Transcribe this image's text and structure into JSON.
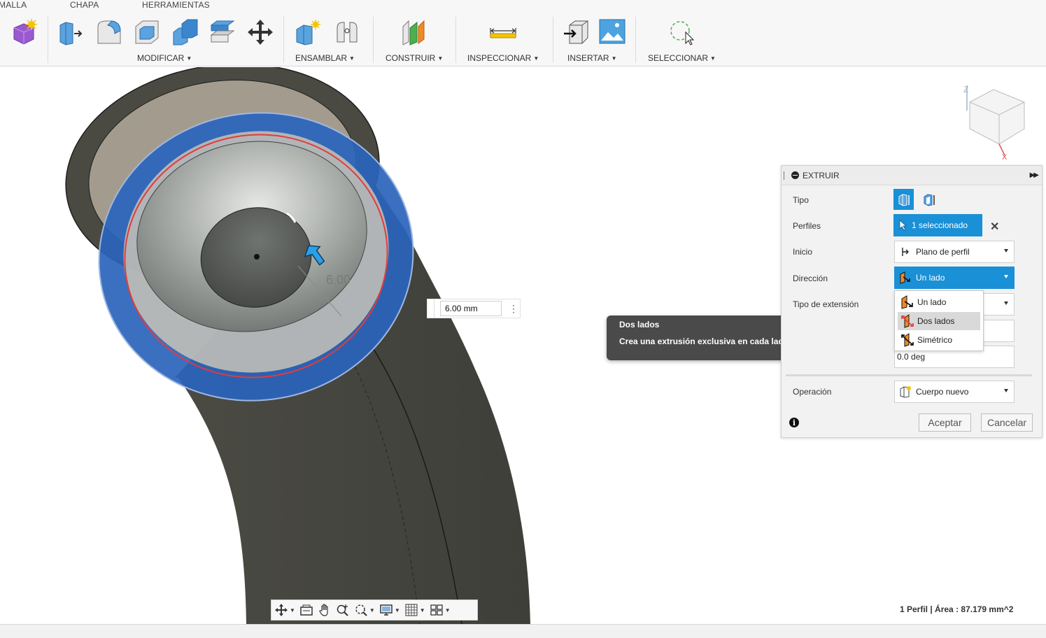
{
  "toolbar": {
    "tabs": [
      "MALLA",
      "CHAPA",
      "HERRAMIENTAS"
    ],
    "groups": {
      "modificar": "MODIFICAR",
      "ensamblar": "ENSAMBLAR",
      "construir": "CONSTRUIR",
      "inspeccionar": "INSPECCIONAR",
      "insertar": "INSERTAR",
      "seleccionar": "SELECCIONAR"
    }
  },
  "viewport": {
    "dimension_input": "6.00 mm",
    "dimension_text": "6.00"
  },
  "tooltip": {
    "title": "Dos lados",
    "body": "Crea una extrusión exclusiva en cada lado del plano del perfil."
  },
  "dialog": {
    "title": "EXTRUIR",
    "labels": {
      "tipo": "Tipo",
      "perfiles": "Perfiles",
      "inicio": "Inicio",
      "direccion": "Dirección",
      "tipo_extension": "Tipo de extensión",
      "operacion": "Operación"
    },
    "perfiles_value": "1 seleccionado",
    "inicio_value": "Plano de perfil",
    "direccion_value": "Un lado",
    "angle_value": "0.0 deg",
    "operacion_value": "Cuerpo nuevo",
    "accept": "Aceptar",
    "cancel": "Cancelar",
    "direction_options": [
      "Un lado",
      "Dos lados",
      "Simétrico"
    ]
  },
  "status": {
    "summary": "1 Perfil | Área : 87.179 mm^2"
  },
  "colors": {
    "accent": "#1a90d6",
    "selection_ring": "#2a64bc",
    "profile_outline": "#e33b3b",
    "body": "#4a4a43"
  }
}
